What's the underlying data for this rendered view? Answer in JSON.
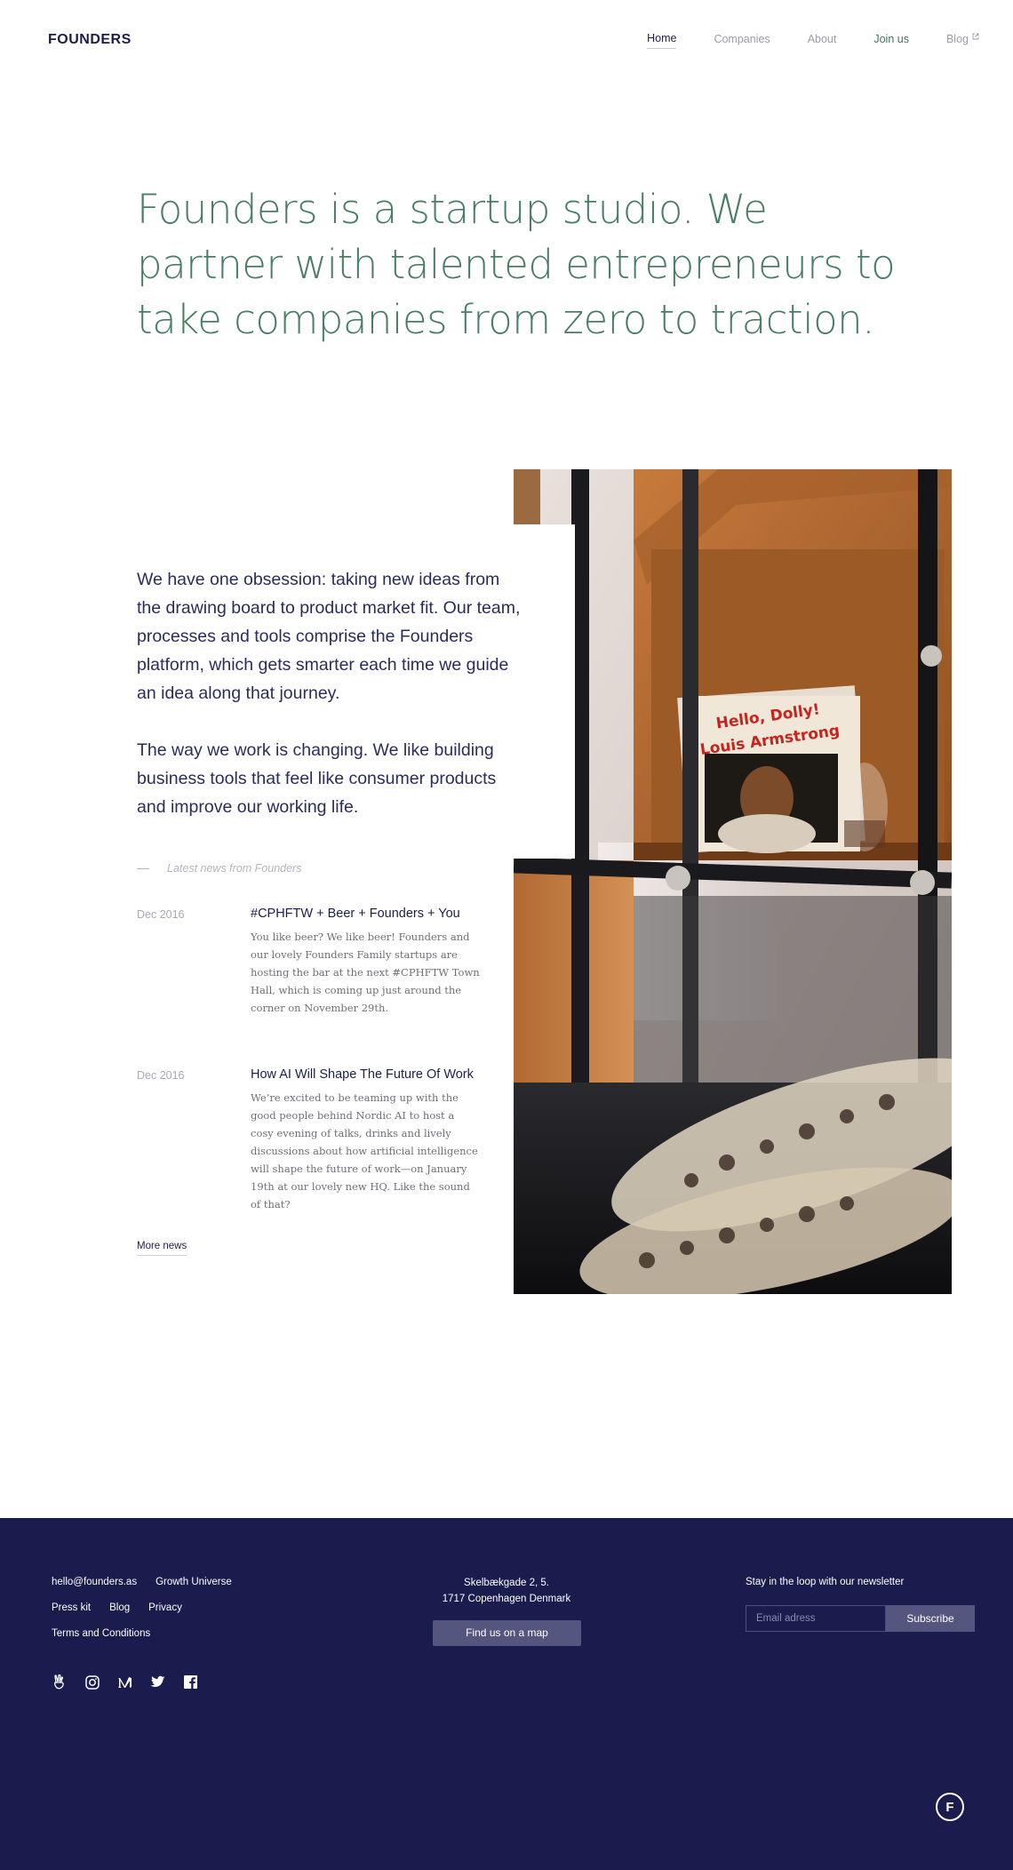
{
  "brand": {
    "logo_text": "FOUNDERS"
  },
  "nav": {
    "items": [
      {
        "label": "Home",
        "active": true
      },
      {
        "label": "Companies"
      },
      {
        "label": "About"
      },
      {
        "label": "Join us"
      },
      {
        "label": "Blog",
        "external": true
      }
    ]
  },
  "hero": {
    "text": "Founders is a startup studio. We partner with talented entrepreneurs to take companies from zero to traction."
  },
  "intro": {
    "paragraph1": "We have one obsession: taking new ideas from the drawing board to product market fit. Our team, processes and tools comprise the Founders platform, which gets smarter each time we guide an idea along that journey.",
    "paragraph2": "The way we work is changing. We like building business tools that feel like consumer products and improve our working life."
  },
  "news": {
    "heading": "Latest news from Founders",
    "items": [
      {
        "date": "Dec 2016",
        "title": "#CPHFTW + Beer + Founders + You",
        "body": "You like beer? We like beer! Founders and our lovely Founders Family startups are hosting the bar at the next #CPHFTW Town Hall, which is coming up just around the corner on November 29th."
      },
      {
        "date": "Dec 2016",
        "title": "How AI Will Shape The Future Of Work",
        "body": "We’re excited to be teaming up with the good people behind Nordic AI to host a cosy evening of talks, drinks and lively discussions about how artificial intelligence will shape the future of work—on January 19th at our lovely new HQ. Like the sound of that?"
      }
    ],
    "more_label": "More news"
  },
  "photo": {
    "record_title_line1": "Hello, Dolly!",
    "record_title_line2": "Louis Armstrong"
  },
  "footer": {
    "links_row1": [
      "hello@founders.as",
      "Growth Universe"
    ],
    "links_row2": [
      "Press kit",
      "Blog",
      "Privacy"
    ],
    "links_row3": [
      "Terms and Conditions"
    ],
    "address_line1": "Skelbækgade 2, 5.",
    "address_line2": "1717 Copenhagen Denmark",
    "map_button": "Find us on a map",
    "newsletter_label": "Stay in the loop with our newsletter",
    "email_placeholder": "Email adress",
    "subscribe_label": "Subscribe",
    "socials": [
      "angellist-icon",
      "instagram-icon",
      "medium-icon",
      "twitter-icon",
      "facebook-icon"
    ],
    "badge_letter": "F"
  },
  "colors": {
    "navy": "#191c4d",
    "hero_green": "#4a7c66",
    "button_muted": "#545680"
  }
}
